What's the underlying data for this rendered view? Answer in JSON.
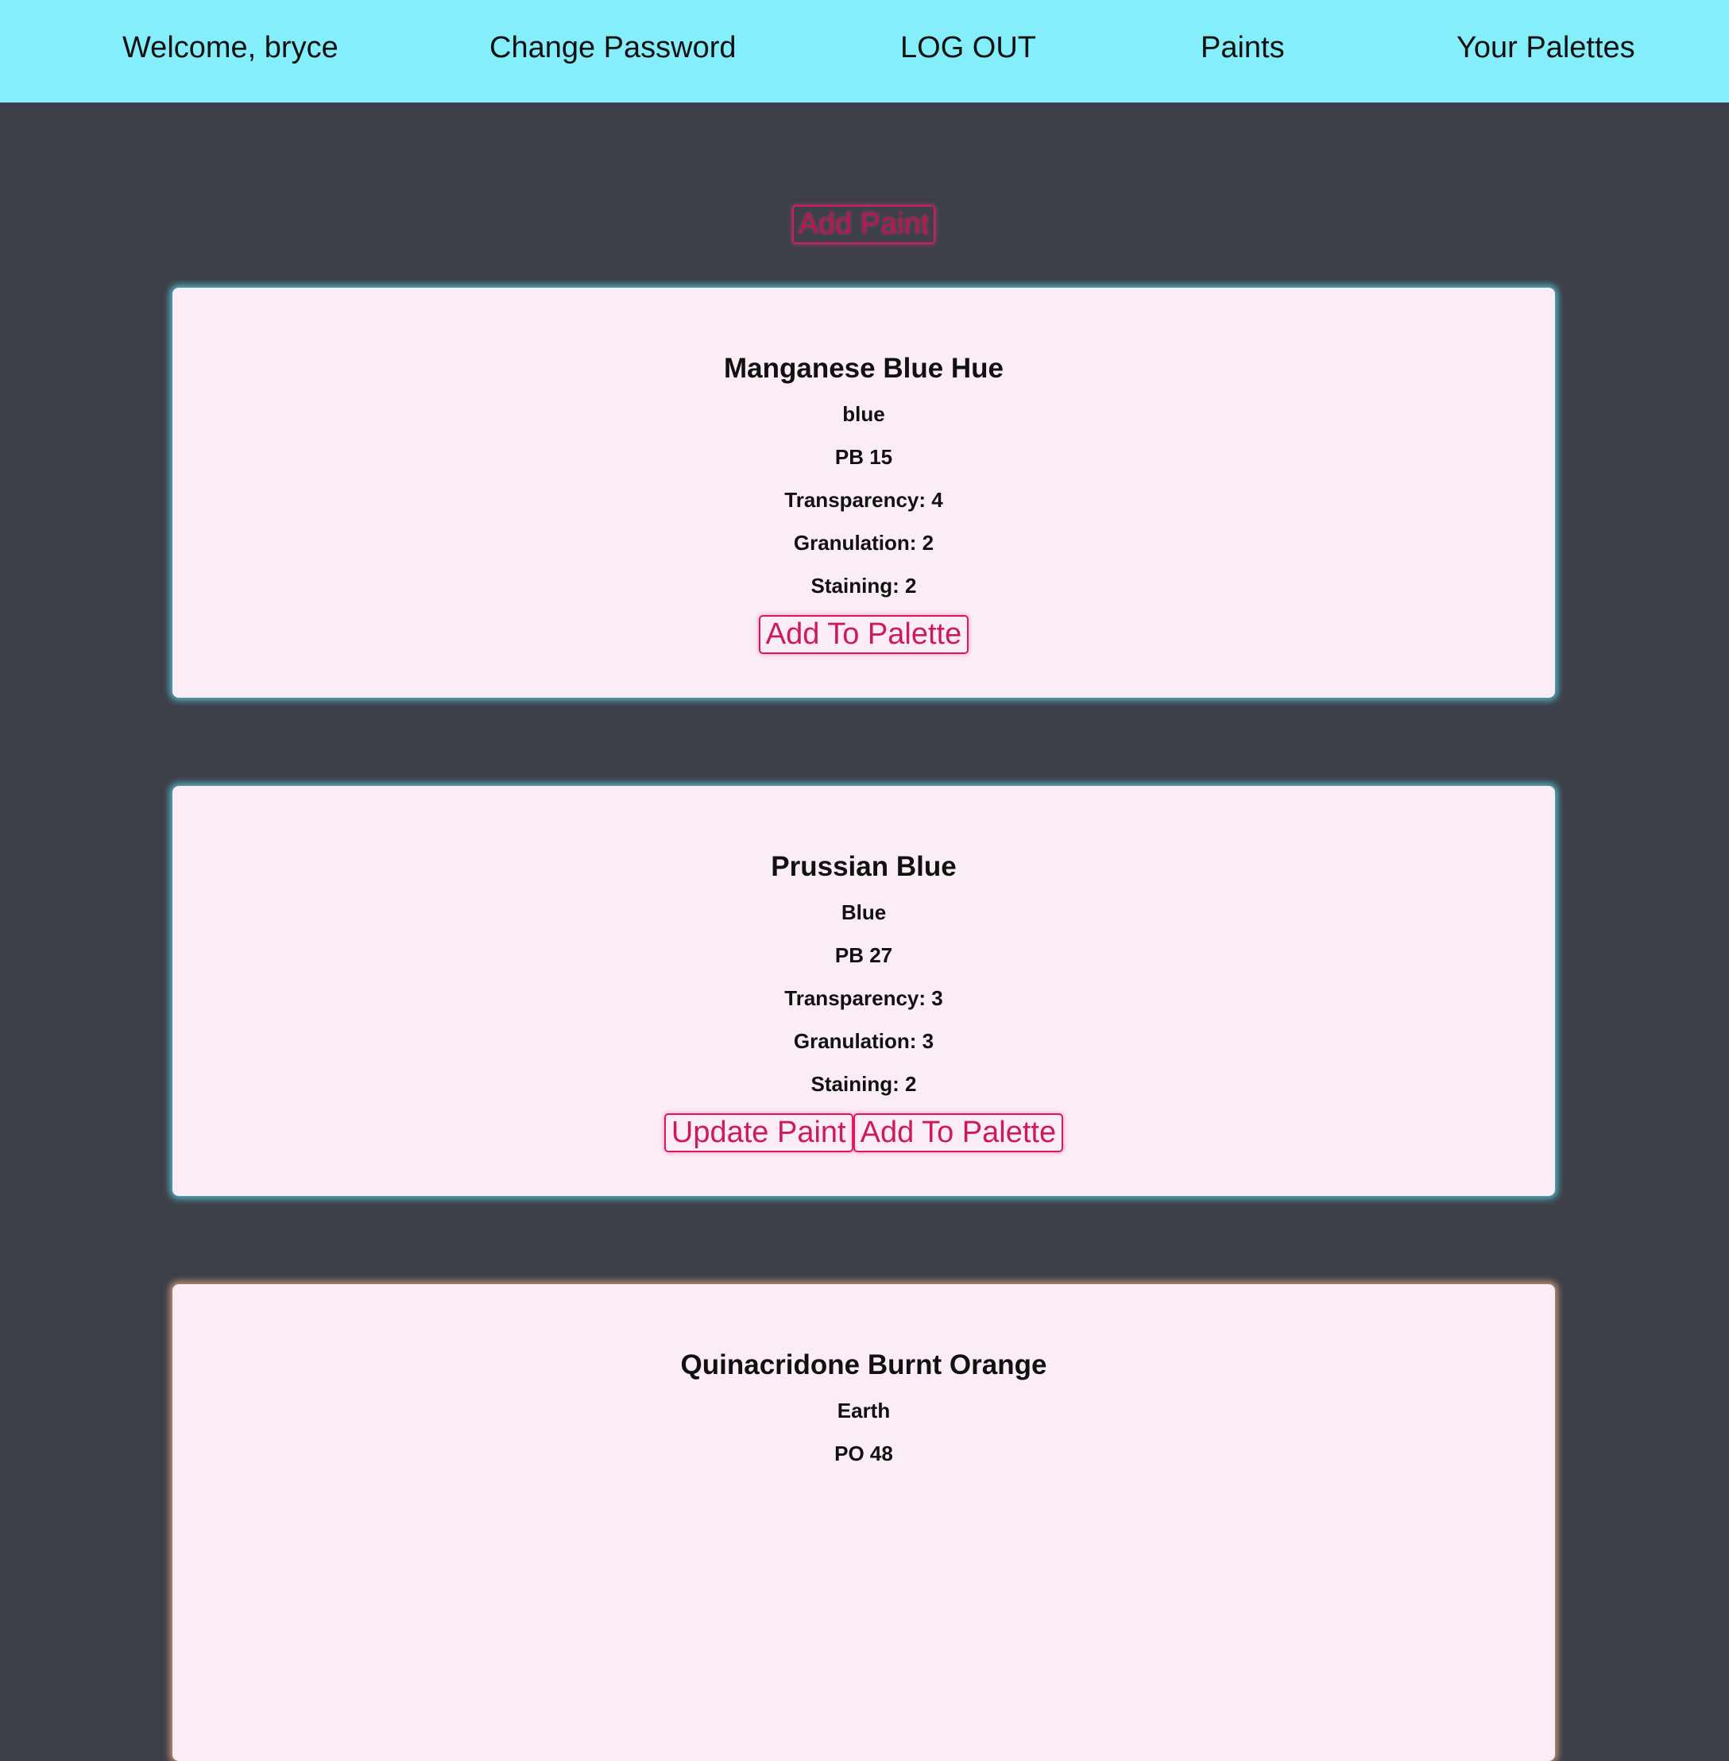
{
  "nav": {
    "welcome": "Welcome, bryce",
    "change_password": "Change Password",
    "log_out": "LOG OUT",
    "paints": "Paints",
    "your_palettes": "Your Palettes"
  },
  "add_paint_label": "Add Paint",
  "colors": {
    "nav_bg": "#84eefb",
    "page_bg": "#3d4049",
    "card_bg": "#fbedf6",
    "button_accent": "#d8185f"
  },
  "paints": [
    {
      "name": "Manganese Blue Hue",
      "family": "blue",
      "pigment": "PB 15",
      "transparency": "Transparency: 4",
      "granulation": "Granulation: 2",
      "staining": "Staining: 2",
      "add_to_palette_label": "Add To Palette"
    },
    {
      "name": "Prussian Blue",
      "family": "Blue",
      "pigment": "PB 27",
      "transparency": "Transparency: 3",
      "granulation": "Granulation: 3",
      "staining": "Staining: 2",
      "update_paint_label": "Update Paint",
      "add_to_palette_label": "Add To Palette"
    },
    {
      "name": "Quinacridone Burnt Orange",
      "family": "Earth",
      "pigment": "PO 48"
    }
  ]
}
